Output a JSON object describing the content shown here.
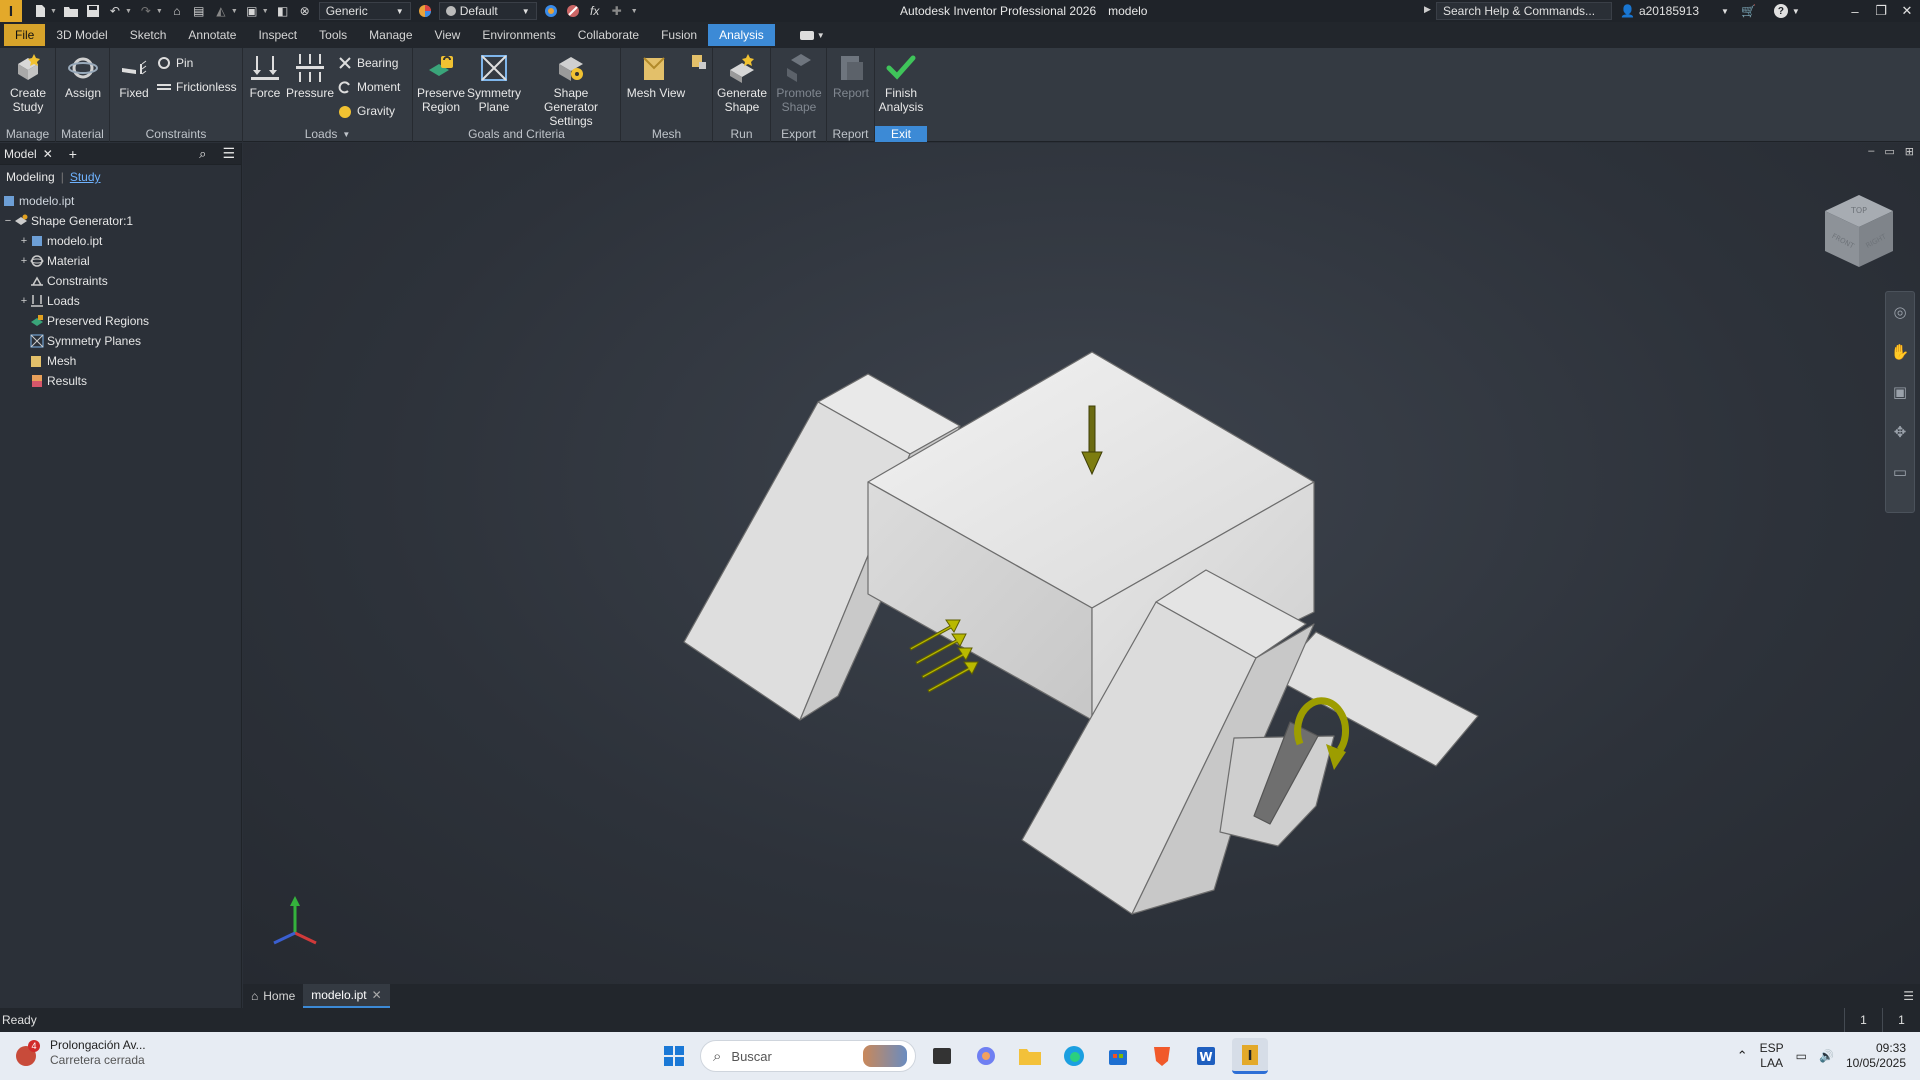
{
  "app": {
    "title": "Autodesk Inventor Professional 2026",
    "document": "modelo",
    "material_select": "Generic",
    "appearance_select": "Default",
    "help_search": "Search Help & Commands...",
    "user": "a20185913"
  },
  "tabs": [
    "File",
    "3D Model",
    "Sketch",
    "Annotate",
    "Inspect",
    "Tools",
    "Manage",
    "View",
    "Environments",
    "Collaborate",
    "Fusion",
    "Analysis"
  ],
  "ribbon": {
    "create_study": "Create\nStudy",
    "assign": "Assign",
    "fixed": "Fixed",
    "pin": "Pin",
    "frictionless": "Frictionless",
    "force": "Force",
    "pressure": "Pressure",
    "bearing": "Bearing",
    "moment": "Moment",
    "gravity": "Gravity",
    "preserve_region": "Preserve\nRegion",
    "symmetry_plane": "Symmetry\nPlane",
    "sg_settings": "Shape Generator\nSettings",
    "mesh_view": "Mesh View",
    "generate_shape": "Generate\nShape",
    "promote_shape": "Promote\nShape",
    "report": "Report",
    "finish_analysis": "Finish\nAnalysis",
    "panels": {
      "manage": "Manage",
      "material": "Material",
      "constraints": "Constraints",
      "loads": "Loads",
      "goals": "Goals and Criteria",
      "mesh": "Mesh",
      "run": "Run",
      "export": "Export",
      "report": "Report",
      "exit": "Exit"
    }
  },
  "browser": {
    "tab": "Model",
    "modeling": "Modeling",
    "study": "Study",
    "root": "modelo.ipt",
    "nodes": [
      {
        "label": "Shape Generator:1"
      },
      {
        "label": "modelo.ipt"
      },
      {
        "label": "Material"
      },
      {
        "label": "Constraints"
      },
      {
        "label": "Loads"
      },
      {
        "label": "Preserved Regions"
      },
      {
        "label": "Symmetry Planes"
      },
      {
        "label": "Mesh"
      },
      {
        "label": "Results"
      }
    ]
  },
  "viewcube": {
    "top": "TOP",
    "front": "FRONT",
    "right": "RIGHT"
  },
  "doctabs": {
    "home": "Home",
    "file": "modelo.ipt"
  },
  "status": {
    "text": "Ready",
    "count1": "1",
    "count2": "1"
  },
  "taskbar": {
    "news_title": "Prolongación Av...",
    "news_sub": "Carretera cerrada",
    "news_badge": "4",
    "search": "Buscar",
    "lang1": "ESP",
    "lang2": "LAA",
    "time": "09:33",
    "date": "10/05/2025"
  }
}
